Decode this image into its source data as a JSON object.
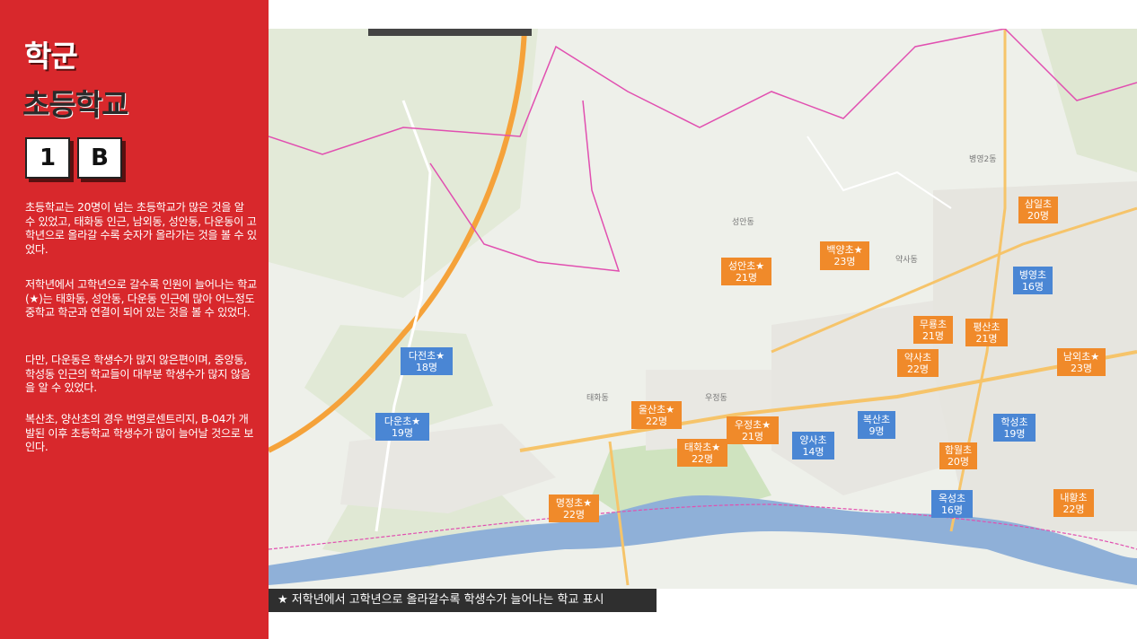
{
  "panel": {
    "title_line1": "학군",
    "title_line2": "초등학교",
    "box1": "1",
    "box2": "B",
    "paragraphs": [
      "초등학교는 20명이 넘는 초등학교가 많은 것을 알 수 있었고, 태화동 인근, 남외동, 성안동, 다운동이 고학년으로 올라갈 수록 숫자가 올라가는 것을 볼 수 있었다.",
      "저학년에서 고학년으로 갈수록 인원이 늘어나는 학교(★)는 태화동, 성안동, 다운동 인근에 많아 어느정도 중학교 학군과 연결이 되어 있는 것을 볼 수 있었다.",
      "다만, 다운동은 학생수가 많지 않은편이며, 중앙동, 학성동 인근의 학교들이 대부분 학생수가 많지 않음을 알 수 있었다.",
      "복산초, 양산초의 경우 번영로센트리지, B-04가 개발된 이후 초등학교 학생수가 많이 늘어날 것으로 보인다."
    ]
  },
  "colors": {
    "panel_red": "#d8282c",
    "label_orange": "#f08a2a",
    "label_blue": "#4a86d4",
    "river": "#8fb0d8",
    "highway": "#f5a23a"
  },
  "map": {
    "place_names": [
      "성안동",
      "약사동",
      "병영2동",
      "우정동",
      "태화동"
    ],
    "schools": [
      {
        "name": "삼일초",
        "count": "20명",
        "type": "orange"
      },
      {
        "name": "백양초★",
        "count": "23명",
        "type": "orange"
      },
      {
        "name": "성안초★",
        "count": "21명",
        "type": "orange"
      },
      {
        "name": "병영초",
        "count": "16명",
        "type": "blue"
      },
      {
        "name": "무룡초",
        "count": "21명",
        "type": "orange"
      },
      {
        "name": "평산초",
        "count": "21명",
        "type": "orange"
      },
      {
        "name": "다전초★",
        "count": "18명",
        "type": "blue"
      },
      {
        "name": "약사초",
        "count": "22명",
        "type": "orange"
      },
      {
        "name": "남외초★",
        "count": "23명",
        "type": "orange"
      },
      {
        "name": "울산초★",
        "count": "22명",
        "type": "orange"
      },
      {
        "name": "복산초",
        "count": "9명",
        "type": "blue"
      },
      {
        "name": "다운초★",
        "count": "19명",
        "type": "blue"
      },
      {
        "name": "우정초★",
        "count": "21명",
        "type": "orange"
      },
      {
        "name": "학성초",
        "count": "19명",
        "type": "blue"
      },
      {
        "name": "태화초★",
        "count": "22명",
        "type": "orange"
      },
      {
        "name": "양사초",
        "count": "14명",
        "type": "blue"
      },
      {
        "name": "함월초",
        "count": "20명",
        "type": "orange"
      },
      {
        "name": "옥성초",
        "count": "16명",
        "type": "blue"
      },
      {
        "name": "내황초",
        "count": "22명",
        "type": "orange"
      },
      {
        "name": "명정초★",
        "count": "22명",
        "type": "orange"
      }
    ]
  },
  "legend": "★ 저학년에서 고학년으로 올라갈수록 학생수가 늘어나는 학교 표시"
}
